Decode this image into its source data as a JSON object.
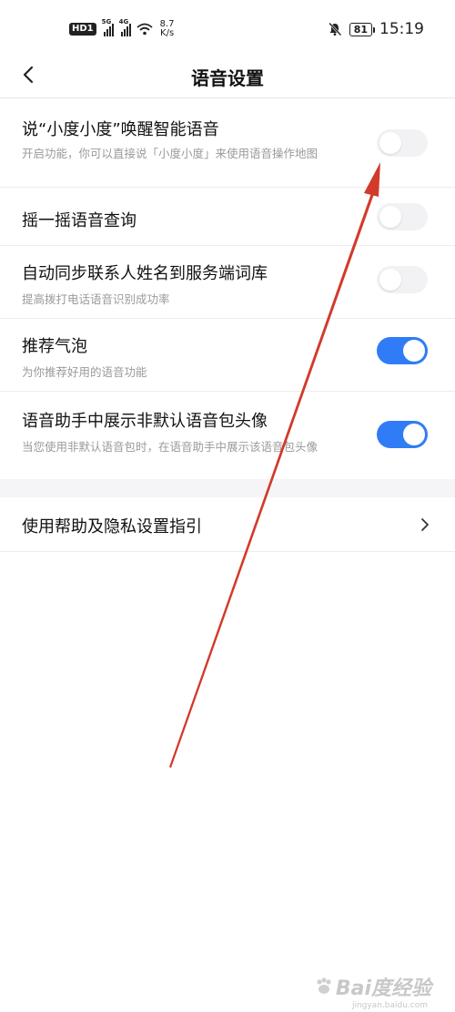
{
  "status_bar": {
    "hd": "HD",
    "hd_num": "1",
    "sig1": "5G",
    "sig2": "4G",
    "speed_value": "8.7",
    "speed_unit": "K/s",
    "battery": "81",
    "time": "15:19"
  },
  "nav": {
    "title": "语音设置",
    "back_icon": "chevron-left-icon"
  },
  "settings": {
    "wake": {
      "title": "说“小度小度”唤醒智能语音",
      "subtitle": "开启功能，你可以直接说「小度小度」来使用语音操作地图",
      "on": false
    },
    "shake": {
      "title": "摇一摇语音查询",
      "on": false
    },
    "sync": {
      "title": "自动同步联系人姓名到服务端词库",
      "subtitle": "提高拨打电话语音识别成功率",
      "on": false
    },
    "bubble": {
      "title": "推荐气泡",
      "subtitle": "为你推荐好用的语音功能",
      "on": true
    },
    "avatar": {
      "title": "语音助手中展示非默认语音包头像",
      "subtitle": "当您使用非默认语音包时，在语音助手中展示该语音包头像",
      "on": true
    }
  },
  "help": {
    "title": "使用帮助及隐私设置指引"
  },
  "colors": {
    "accent": "#2f7cf6",
    "annotation_arrow": "#d23a2a"
  },
  "watermark": {
    "text": "Bai度经验",
    "sub": "jingyan.baidu.com"
  }
}
